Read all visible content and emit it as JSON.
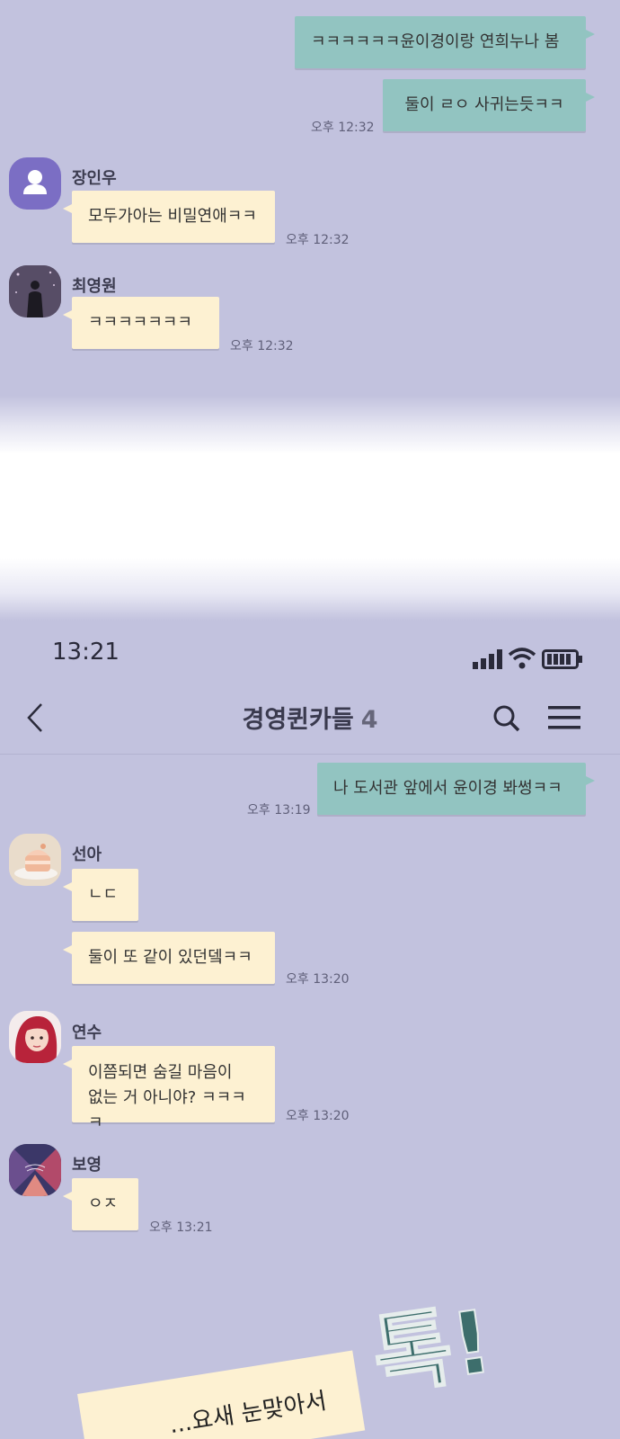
{
  "top_chat": {
    "messages": [
      {
        "type": "sent",
        "text": "ㅋㅋㅋㅋㅋㅋ윤이경이랑 연희누나 봄"
      },
      {
        "type": "sent",
        "text": "둘이 ㄹㅇ 사귀는듯ㅋㅋ",
        "time": "오후 12:32"
      },
      {
        "type": "recv",
        "sender": "장인우",
        "text": "모두가아는 비밀연애ㅋㅋ",
        "time": "오후 12:32"
      },
      {
        "type": "recv",
        "sender": "최영원",
        "text": "ㅋㅋㅋㅋㅋㅋㅋ",
        "time": "오후 12:32"
      }
    ]
  },
  "status_bar": {
    "time": "13:21"
  },
  "header": {
    "back_icon": "chevron-left-icon",
    "title": "경영퀸카들",
    "member_count": "4",
    "search_icon": "search-icon",
    "menu_icon": "hamburger-menu-icon"
  },
  "bottom_chat": {
    "messages": [
      {
        "type": "sent",
        "text": "나 도서관 앞에서 윤이경 봐썽ㅋㅋ",
        "time": "오후 13:19"
      },
      {
        "type": "recv",
        "sender": "선아",
        "text": "ㄴㄷ"
      },
      {
        "type": "recv",
        "text": "둘이 또 같이 있던뎈ㅋㅋ",
        "time": "오후 13:20"
      },
      {
        "type": "recv",
        "sender": "연수",
        "text_line1": "이쯤되면 숨길 마음이",
        "text_line2": "없는 거 아니야? ㅋㅋㅋㅋ",
        "time": "오후 13:20"
      },
      {
        "type": "recv",
        "sender": "보영",
        "text": "ㅇㅈ",
        "time": "오후 13:21"
      }
    ]
  },
  "overlay": {
    "sfx_text": "톡!",
    "paper_text": "...요새 눈맞아서"
  },
  "colors": {
    "background": "#c2c2de",
    "sent_bubble": "#92c4c1",
    "recv_bubble": "#fdf1d2",
    "sfx": "#3d6e6c"
  }
}
